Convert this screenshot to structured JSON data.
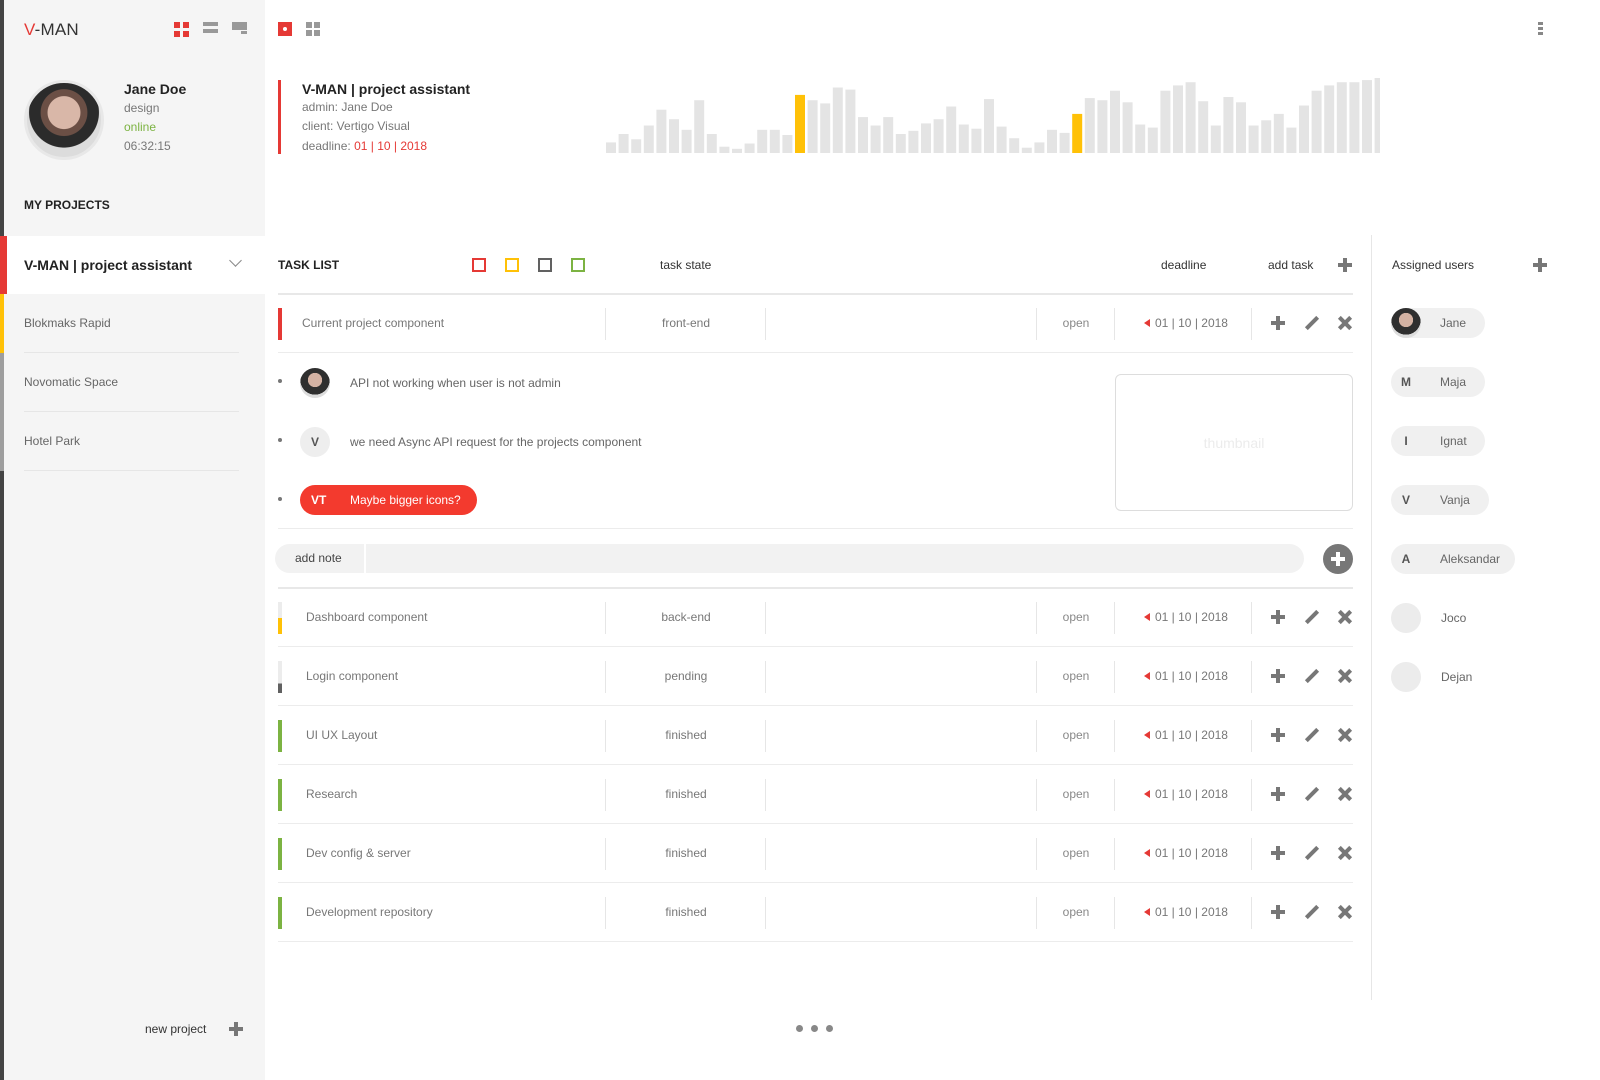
{
  "brand": {
    "prefix": "V",
    "suffix": "-MAN"
  },
  "user": {
    "name": "Jane Doe",
    "role": "design",
    "status": "online",
    "time": "06:32:15"
  },
  "sidebar": {
    "section_title": "MY PROJECTS",
    "active_project": "V-MAN | project assistant",
    "projects": [
      {
        "label": "Blokmaks Rapid",
        "color": "#ffc107"
      },
      {
        "label": "Novomatic Space",
        "color": "#9e9e9e"
      },
      {
        "label": "Hotel Park",
        "color": "#9e9e9e"
      }
    ],
    "new_project_label": "new project"
  },
  "project": {
    "title": "V-MAN | project assistant",
    "admin_label": "admin: Jane Doe",
    "client_label": "client: Vertigo Visual",
    "deadline_label": "deadline:",
    "deadline_value": "01 | 10 | 2018"
  },
  "activity_chart": {
    "bars": [
      10,
      18,
      13,
      26,
      41,
      32,
      22,
      50,
      18,
      6,
      4,
      9,
      22,
      22,
      17,
      55,
      50,
      47,
      62,
      60,
      34,
      26,
      34,
      18,
      21,
      28,
      32,
      44,
      27,
      23,
      51,
      25,
      14,
      5,
      10,
      22,
      19,
      37,
      52,
      50,
      59,
      48,
      27,
      24,
      59,
      64,
      67,
      49,
      26,
      53,
      48,
      26,
      31,
      37,
      24,
      45,
      59,
      64,
      67,
      67,
      69,
      71
    ],
    "highlight": [
      15,
      37
    ],
    "colors": {
      "normal": "#e4e4e4",
      "highlight": "#ffc107"
    }
  },
  "task_list": {
    "title": "TASK LIST",
    "filters": [
      {
        "name": "red",
        "color": "#e53935"
      },
      {
        "name": "yellow",
        "color": "#ffc107"
      },
      {
        "name": "gray",
        "color": "#616161"
      },
      {
        "name": "green",
        "color": "#7cb342"
      }
    ],
    "task_state_label": "task state",
    "deadline_label": "deadline",
    "add_task_label": "add task",
    "tasks": [
      {
        "name": "Current project component",
        "type": "front-end",
        "status": "open",
        "deadline": "01 | 10 | 2018",
        "color": "#e53935"
      },
      {
        "name": "Dashboard component",
        "type": "back-end",
        "status": "open",
        "deadline": "01 | 10 | 2018",
        "color": "#ffc107"
      },
      {
        "name": "Login component",
        "type": "pending",
        "status": "open",
        "deadline": "01 | 10 | 2018",
        "color": "#616161"
      },
      {
        "name": "UI UX Layout",
        "type": "finished",
        "status": "open",
        "deadline": "01 | 10 | 2018",
        "color": "#7cb342"
      },
      {
        "name": "Research",
        "type": "finished",
        "status": "open",
        "deadline": "01 | 10 | 2018",
        "color": "#7cb342"
      },
      {
        "name": "Dev config & server",
        "type": "finished",
        "status": "open",
        "deadline": "01 | 10 | 2018",
        "color": "#7cb342"
      },
      {
        "name": "Development repository",
        "type": "finished",
        "status": "open",
        "deadline": "01 | 10 | 2018",
        "color": "#7cb342"
      }
    ],
    "notes": [
      {
        "avatar": "photo",
        "text": "API not working when user is not admin"
      },
      {
        "avatar": "V",
        "text": "we need Async API request for the projects component"
      },
      {
        "avatar": "VT",
        "text": "Maybe bigger icons?"
      }
    ],
    "thumbnail_label": "thumbnail",
    "add_note_label": "add note"
  },
  "assigned_users": {
    "title": "Assigned users",
    "users": [
      {
        "initial": "",
        "name": "Jane"
      },
      {
        "initial": "M",
        "name": "Maja"
      },
      {
        "initial": "I",
        "name": "Ignat"
      },
      {
        "initial": "V",
        "name": "Vanja"
      },
      {
        "initial": "A",
        "name": "Aleksandar"
      },
      {
        "initial": "",
        "name": "Joco"
      },
      {
        "initial": "",
        "name": "Dejan"
      }
    ]
  }
}
